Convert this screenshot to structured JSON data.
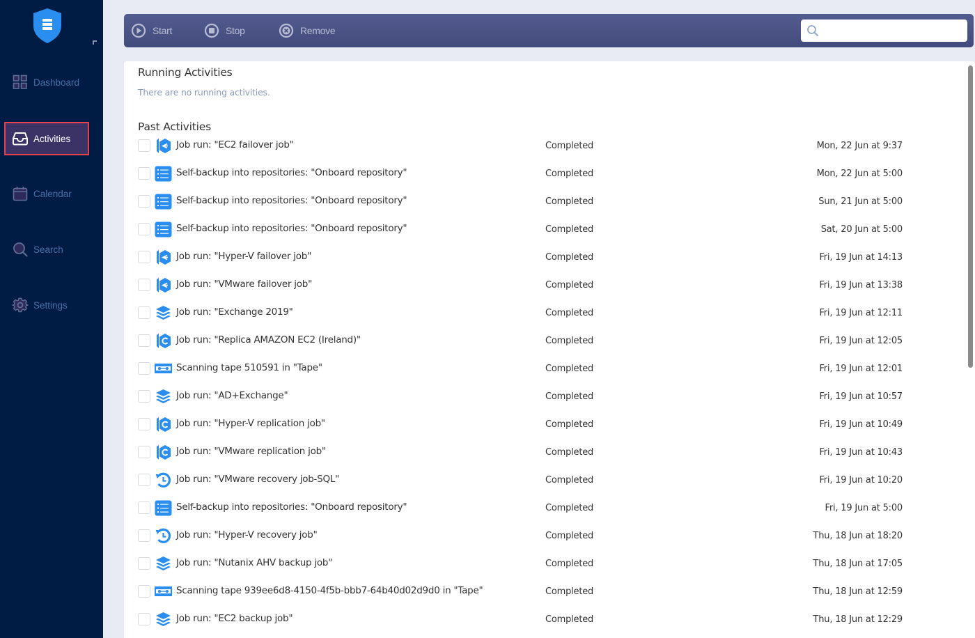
{
  "sidebar": {
    "items": [
      {
        "label": "Dashboard",
        "icon": "dashboard-grid-icon",
        "active": false
      },
      {
        "label": "Activities",
        "icon": "inbox-tray-icon",
        "active": true
      },
      {
        "label": "Calendar",
        "icon": "calendar-icon",
        "active": false
      },
      {
        "label": "Search",
        "icon": "search-icon",
        "active": false
      },
      {
        "label": "Settings",
        "icon": "gear-icon",
        "active": false
      }
    ]
  },
  "toolbar": {
    "start_label": "Start",
    "stop_label": "Stop",
    "remove_label": "Remove",
    "search_value": "",
    "search_placeholder": ""
  },
  "running": {
    "title": "Running Activities",
    "empty_message": "There are no running activities."
  },
  "past": {
    "title": "Past Activities",
    "rows": [
      {
        "icon": "failover",
        "name": "Job run: \"EC2 failover job\"",
        "status": "Completed",
        "time": "Mon, 22 Jun at 9:37"
      },
      {
        "icon": "self-backup",
        "name": "Self-backup into repositories: \"Onboard repository\"",
        "status": "Completed",
        "time": "Mon, 22 Jun at 5:00"
      },
      {
        "icon": "self-backup",
        "name": "Self-backup into repositories: \"Onboard repository\"",
        "status": "Completed",
        "time": "Sun, 21 Jun at 5:00"
      },
      {
        "icon": "self-backup",
        "name": "Self-backup into repositories: \"Onboard repository\"",
        "status": "Completed",
        "time": "Sat, 20 Jun at 5:00"
      },
      {
        "icon": "failover",
        "name": "Job run: \"Hyper-V failover job\"",
        "status": "Completed",
        "time": "Fri, 19 Jun at 14:13"
      },
      {
        "icon": "failover",
        "name": "Job run: \"VMware failover job\"",
        "status": "Completed",
        "time": "Fri, 19 Jun at 13:38"
      },
      {
        "icon": "backup",
        "name": "Job run: \"Exchange 2019\"",
        "status": "Completed",
        "time": "Fri, 19 Jun at 12:11"
      },
      {
        "icon": "replication",
        "name": "Job run: \"Replica AMAZON EC2 (Ireland)\"",
        "status": "Completed",
        "time": "Fri, 19 Jun at 12:05"
      },
      {
        "icon": "tape",
        "name": "Scanning tape 510591 in \"Tape\"",
        "status": "Completed",
        "time": "Fri, 19 Jun at 12:01"
      },
      {
        "icon": "backup",
        "name": "Job run: \"AD+Exchange\"",
        "status": "Completed",
        "time": "Fri, 19 Jun at 10:57"
      },
      {
        "icon": "replication",
        "name": "Job run: \"Hyper-V replication job\"",
        "status": "Completed",
        "time": "Fri, 19 Jun at 10:49"
      },
      {
        "icon": "replication",
        "name": "Job run: \"VMware replication job\"",
        "status": "Completed",
        "time": "Fri, 19 Jun at 10:43"
      },
      {
        "icon": "recovery",
        "name": "Job run: \"VMware recovery job-SQL\"",
        "status": "Completed",
        "time": "Fri, 19 Jun at 10:20"
      },
      {
        "icon": "self-backup",
        "name": "Self-backup into repositories: \"Onboard repository\"",
        "status": "Completed",
        "time": "Fri, 19 Jun at 5:00"
      },
      {
        "icon": "recovery",
        "name": "Job run: \"Hyper-V recovery job\"",
        "status": "Completed",
        "time": "Thu, 18 Jun at 18:20"
      },
      {
        "icon": "backup",
        "name": "Job run: \"Nutanix AHV backup job\"",
        "status": "Completed",
        "time": "Thu, 18 Jun at 17:05"
      },
      {
        "icon": "tape",
        "name": "Scanning tape 939ee6d8-4150-4f5b-bbb7-64b40d02d9d0 in \"Tape\"",
        "status": "Completed",
        "time": "Thu, 18 Jun at 12:59"
      },
      {
        "icon": "backup",
        "name": "Job run: \"EC2 backup job\"",
        "status": "Completed",
        "time": "Thu, 18 Jun at 12:29"
      }
    ]
  },
  "colors": {
    "sidebar_bg": "#001c45",
    "active_item_bg": "#3b3366",
    "active_outline": "#e8414a",
    "toolbar_bg": "#4b5286",
    "icon_blue": "#2a8ef0"
  }
}
